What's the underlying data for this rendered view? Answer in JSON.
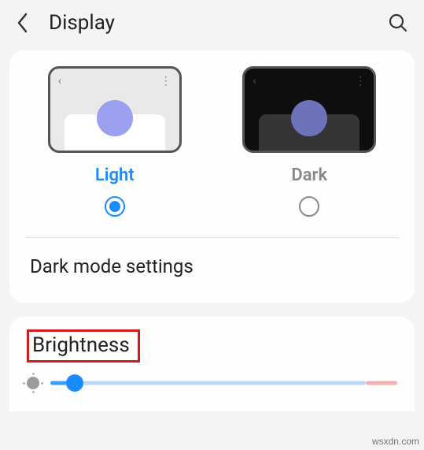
{
  "header": {
    "title": "Display"
  },
  "themes": {
    "light": {
      "label": "Light",
      "selected": true
    },
    "dark": {
      "label": "Dark",
      "selected": false
    }
  },
  "darkModeSettings": {
    "label": "Dark mode settings"
  },
  "brightness": {
    "label": "Brightness",
    "value_percent": 7
  },
  "watermark": "wsxdn.com"
}
